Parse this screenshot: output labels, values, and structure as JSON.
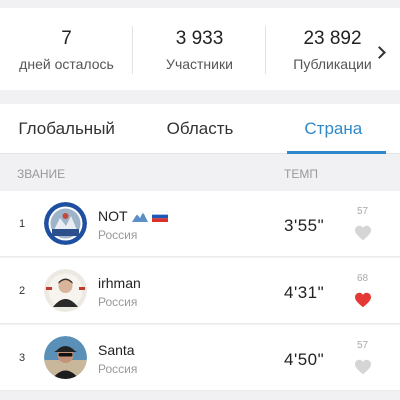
{
  "stats": [
    {
      "value": "7",
      "label": "дней осталось"
    },
    {
      "value": "3 933",
      "label": "Участники"
    },
    {
      "value": "23 892",
      "label": "Публикации"
    }
  ],
  "tabs": [
    {
      "label": "Глобальный",
      "active": false
    },
    {
      "label": "Область",
      "active": false
    },
    {
      "label": "Страна",
      "active": true
    }
  ],
  "columns": {
    "rank": "ЗВАНИЕ",
    "pace": "ТЕМП"
  },
  "rows": [
    {
      "rank": "1",
      "name": "NOT",
      "country": "Россия",
      "pace": "3'55\"",
      "likes": "57",
      "liked": false
    },
    {
      "rank": "2",
      "name": "irhman",
      "country": "Россия",
      "pace": "4'31\"",
      "likes": "68",
      "liked": true
    },
    {
      "rank": "3",
      "name": "Santa",
      "country": "Россия",
      "pace": "4'50\"",
      "likes": "57",
      "liked": false
    }
  ],
  "colors": {
    "accent": "#2f88c8",
    "heart_active": "#e53935",
    "heart_inactive": "#d5d5d5"
  }
}
